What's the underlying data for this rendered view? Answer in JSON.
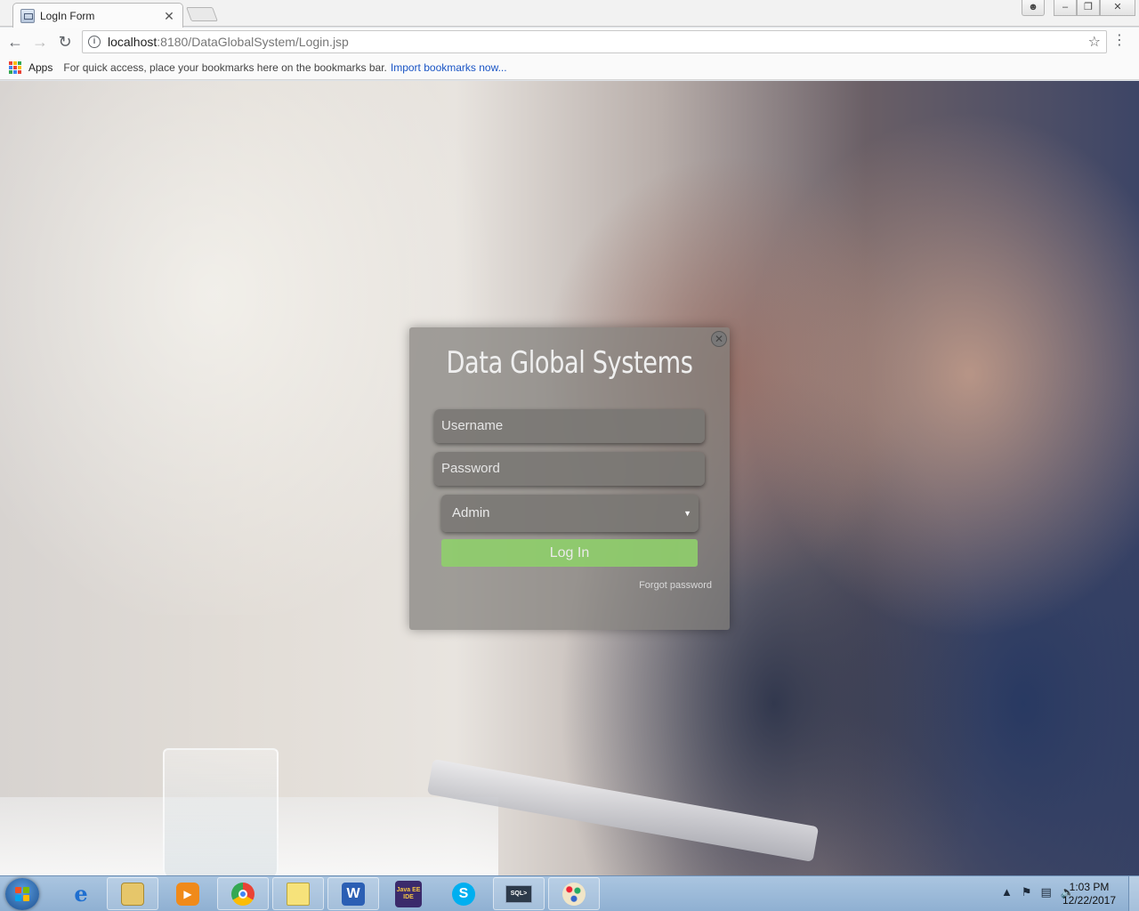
{
  "browser": {
    "tab_title": "LogIn Form",
    "url_host": "localhost",
    "url_path": ":8180/DataGlobalSystem/Login.jsp",
    "bookmarks": {
      "apps_label": "Apps",
      "hint_text": "For quick access, place your bookmarks here on the bookmarks bar.",
      "import_link": "Import bookmarks now..."
    }
  },
  "login": {
    "title": "Data Global Systems",
    "username_placeholder": "Username",
    "password_placeholder": "Password",
    "role_selected": "Admin",
    "login_button": "Log In",
    "forgot_link": "Forgot password",
    "button_color": "#8fcf6b"
  },
  "taskbar": {
    "items": [
      {
        "name": "internet-explorer-icon"
      },
      {
        "name": "file-explorer-icon"
      },
      {
        "name": "media-player-icon"
      },
      {
        "name": "chrome-icon"
      },
      {
        "name": "sticky-notes-icon"
      },
      {
        "name": "word-icon",
        "label": "W"
      },
      {
        "name": "java-ee-ide-icon",
        "label": "Java EE IDE"
      },
      {
        "name": "skype-icon",
        "label": "S"
      },
      {
        "name": "sql-plus-icon",
        "label": "SQL>"
      },
      {
        "name": "paint-icon"
      }
    ],
    "clock_time": "1:03 PM",
    "clock_date": "12/22/2017"
  }
}
